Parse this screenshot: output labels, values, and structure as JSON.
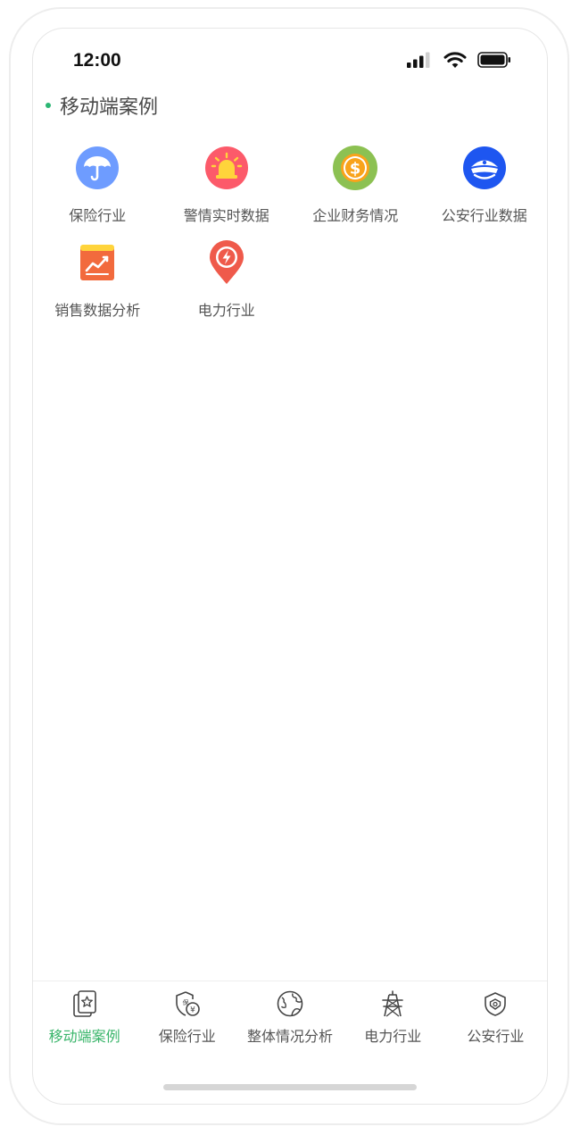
{
  "status": {
    "time": "12:00",
    "icons": [
      "signal-icon",
      "wifi-icon",
      "battery-icon"
    ]
  },
  "section": {
    "title": "移动端案例"
  },
  "apps": [
    {
      "label": "保险行业",
      "icon": "umbrella-icon",
      "color": "#6e9cff"
    },
    {
      "label": "警情实时数据",
      "icon": "alarm-light-icon",
      "color": "#fc5a6a"
    },
    {
      "label": "企业财务情况",
      "icon": "dollar-coin-icon",
      "color": "#8cc152"
    },
    {
      "label": "公安行业数据",
      "icon": "police-cap-icon",
      "color": "#1e56f0"
    },
    {
      "label": "销售数据分析",
      "icon": "sales-chart-icon",
      "color": "#f26a3d"
    },
    {
      "label": "电力行业",
      "icon": "power-pin-icon",
      "color": "#ef5a4b"
    }
  ],
  "tabs": [
    {
      "label": "移动端案例",
      "icon": "star-card-icon",
      "active": true
    },
    {
      "label": "保险行业",
      "icon": "shield-yuan-icon",
      "active": false
    },
    {
      "label": "整体情况分析",
      "icon": "globe-icon",
      "active": false
    },
    {
      "label": "电力行业",
      "icon": "power-tower-icon",
      "active": false
    },
    {
      "label": "公安行业",
      "icon": "police-badge-icon",
      "active": false
    }
  ],
  "colors": {
    "accent": "#39b56a",
    "section_dot": "#2bb673",
    "text": "#555555"
  }
}
